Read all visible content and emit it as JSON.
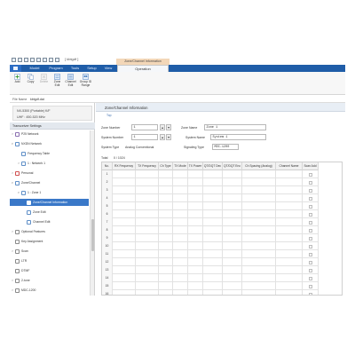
{
  "title_bar": {
    "title": "[ kbtgdf ]",
    "context_tab_label": "Zone/Channel Information"
  },
  "ribbon_tabs": [
    {
      "label": "",
      "name": "file"
    },
    {
      "label": "Model",
      "name": "model"
    },
    {
      "label": "Program",
      "name": "program"
    },
    {
      "label": "Tools",
      "name": "tools"
    },
    {
      "label": "Setup",
      "name": "setup"
    },
    {
      "label": "View",
      "name": "view"
    },
    {
      "label": "Operation",
      "name": "operation"
    }
  ],
  "ribbon_buttons": [
    {
      "label": "Add",
      "icon": "add-icon",
      "enabled": true
    },
    {
      "label": "Copy",
      "icon": "copy-icon",
      "enabled": true
    },
    {
      "label": "Delete",
      "icon": "delete-icon",
      "enabled": false
    },
    {
      "label": "Zone\nEdit",
      "icon": "zone-edit-icon",
      "enabled": true
    },
    {
      "label": "Channel\nEdit",
      "icon": "channel-edit-icon",
      "enabled": true
    },
    {
      "label": "Group ID\nRange",
      "icon": "group-id-range-icon",
      "enabled": true
    }
  ],
  "file_row": {
    "label": "File Name",
    "value": "kbtgdf.dat"
  },
  "model_info": {
    "line1": "NX-5300 (Portable) K/F",
    "line2": "UHF : 450-520 MHz"
  },
  "tree_header": "Transceiver Settings",
  "tree": [
    {
      "label": "P25 Network",
      "level": 1,
      "chevron": ">",
      "icon_color": "#8a6fb0"
    },
    {
      "label": "NXDN Network",
      "level": 1,
      "chevron": "v",
      "icon_color": "#5f8fc7"
    },
    {
      "label": "Frequency Table",
      "level": 2,
      "chevron": "",
      "icon_color": "#5f8fc7"
    },
    {
      "label": "1 : Network 1",
      "level": 2,
      "chevron": ">",
      "icon_color": "#5f8fc7"
    },
    {
      "label": "Personal",
      "level": 1,
      "chevron": ">",
      "icon_color": "#d05050"
    },
    {
      "label": "Zone/Channel",
      "level": 1,
      "chevron": "v",
      "icon_color": "#5f8fc7"
    },
    {
      "label": "1 : Zone 1",
      "level": 2,
      "chevron": "v",
      "icon_color": "#5f8fc7"
    },
    {
      "label": "Zone/Channel Information",
      "level": 3,
      "chevron": "",
      "icon_color": "#ffffff",
      "selected": true
    },
    {
      "label": "Zone Edit",
      "level": 3,
      "chevron": "",
      "icon_color": "#5f8fc7"
    },
    {
      "label": "Channel Edit",
      "level": 3,
      "chevron": "",
      "icon_color": "#5f8fc7"
    },
    {
      "label": "Optional Features",
      "level": 1,
      "chevron": ">",
      "icon_color": "#8a8a8a"
    },
    {
      "label": "Key Assignment",
      "level": 1,
      "chevron": "",
      "icon_color": "#8a8a8a"
    },
    {
      "label": "Scan",
      "level": 1,
      "chevron": ">",
      "icon_color": "#8a8a8a"
    },
    {
      "label": "LTR",
      "level": 1,
      "chevron": "",
      "icon_color": "#8a8a8a"
    },
    {
      "label": "DTMF",
      "level": 1,
      "chevron": "",
      "icon_color": "#8a8a8a"
    },
    {
      "label": "2-tone",
      "level": 1,
      "chevron": ">",
      "icon_color": "#8a8a8a"
    },
    {
      "label": "MDC-1200",
      "level": 1,
      "chevron": ">",
      "icon_color": "#8a8a8a"
    }
  ],
  "panel": {
    "title": "Zone/Channel Information",
    "subtab": "Top"
  },
  "form": {
    "zone_number_label": "Zone Number",
    "zone_number_value": "1",
    "zone_name_label": "Zone Name",
    "zone_name_value": "Zone 1",
    "system_number_label": "System Number",
    "system_number_value": "1",
    "system_name_label": "System Name",
    "system_name_value": "System 1",
    "system_type_label": "System Type",
    "system_type_value": "Analog Conventional",
    "signaling_type_label": "Signaling Type",
    "signaling_type_value": "MDC-1200",
    "total_label": "Total",
    "total_value": "0 / 1024",
    "spin_up": "▲",
    "spin_down": "▼"
  },
  "grid": {
    "headers": [
      "No.",
      "RX Frequency",
      "TX Frequency",
      "Ch Type",
      "TX Mode",
      "TX Power",
      "QT/DQT Dec",
      "QT/DQT Enc",
      "Ch Spacing (Analog)",
      "Channel Name",
      "Scan Add"
    ],
    "rows": [
      "1",
      "2",
      "3",
      "4",
      "5",
      "6",
      "7",
      "8",
      "9",
      "10",
      "11",
      "12",
      "13",
      "14",
      "15",
      "16"
    ]
  },
  "colors": {
    "ribbon_blue": "#1f5da8",
    "selection_blue": "#3a78c8",
    "context_tab": "#f3d7b8"
  }
}
